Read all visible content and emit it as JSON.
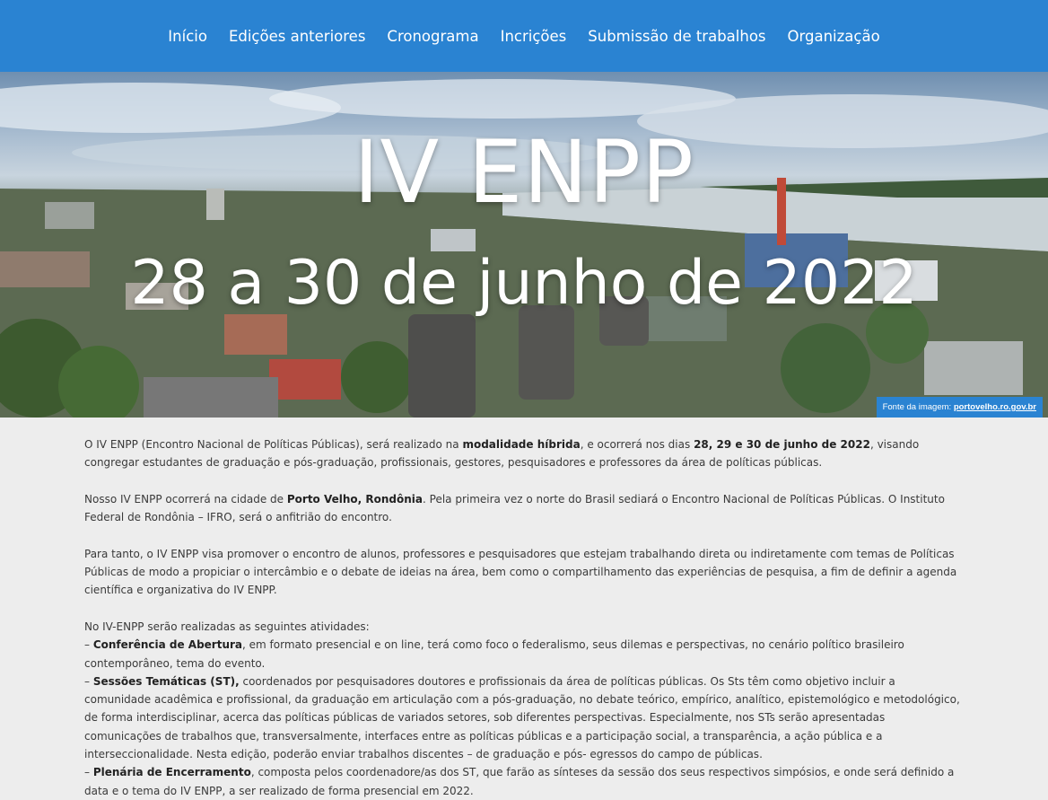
{
  "nav": {
    "items": [
      {
        "label": "Início"
      },
      {
        "label": "Edições anteriores"
      },
      {
        "label": "Cronograma"
      },
      {
        "label": "Incrições"
      },
      {
        "label": "Submissão de trabalhos"
      },
      {
        "label": "Organização"
      }
    ]
  },
  "hero": {
    "title": "IV ENPP",
    "dates": "28 a 30 de junho de 2022",
    "credit_prefix": "Fonte da imagem: ",
    "credit_link": "portovelho.ro.gov.br"
  },
  "content": {
    "p1": {
      "a": "O IV ENPP (Encontro Nacional de Políticas Públicas), será realizado na ",
      "b": "modalidade híbrida",
      "c": ", e ocorrerá nos dias ",
      "d": "28, 29 e 30 de junho de 2022",
      "e": ", visando congregar estudantes de graduação e pós-graduação, profissionais, gestores, pesquisadores e professores da área de políticas públicas."
    },
    "p2": {
      "a": "Nosso IV ENPP ocorrerá na cidade de ",
      "b": "Porto Velho, Rondônia",
      "c": ". Pela primeira vez o norte do Brasil sediará o Encontro Nacional de Políticas Públicas. O Instituto Federal de Rondônia – IFRO, será o anfitrião do encontro."
    },
    "p3": "Para tanto, o IV ENPP visa promover o encontro de alunos, professores e pesquisadores que estejam trabalhando direta ou indiretamente com temas de Políticas Públicas de modo a propiciar o intercâmbio e o debate de ideias na área, bem como o compartilhamento das experiências de pesquisa, a fim de definir a agenda científica e organizativa do IV ENPP.",
    "p4": {
      "intro": "No IV-ENPP serão realizadas as seguintes atividades:",
      "dash": "– ",
      "i1_bold": "Conferência de Abertura",
      "i1_text": ", em formato presencial e on line, terá como foco o federalismo, seus dilemas e perspectivas, no cenário político brasileiro contemporâneo, tema do evento.",
      "i2_bold": "Sessões Temáticas (ST),",
      "i2_text": " coordenados por pesquisadores doutores e profissionais da área de políticas públicas. Os Sts têm como objetivo incluir a comunidade acadêmica e profissional, da graduação em articulação com a pós-graduação, no debate teórico, empírico, analítico, epistemológico e metodológico, de forma interdisciplinar, acerca das políticas públicas de variados setores, sob diferentes perspectivas. Especialmente, nos STs serão apresentadas comunicações de trabalhos que, transversalmente, interfaces entre as políticas públicas e a participação social, a transparência, a ação pública e a interseccionalidade. Nesta edição, poderão enviar trabalhos discentes – de graduação e pós- egressos do campo de públicas.",
      "i3_bold": "Plenária de Encerramento",
      "i3_text": ", composta pelos coordenadore/as dos ST, que farão as sínteses da sessão dos seus respectivos simpósios, e onde será definido a data e o tema do IV ENPP, a ser realizado de forma presencial em 2022."
    }
  }
}
